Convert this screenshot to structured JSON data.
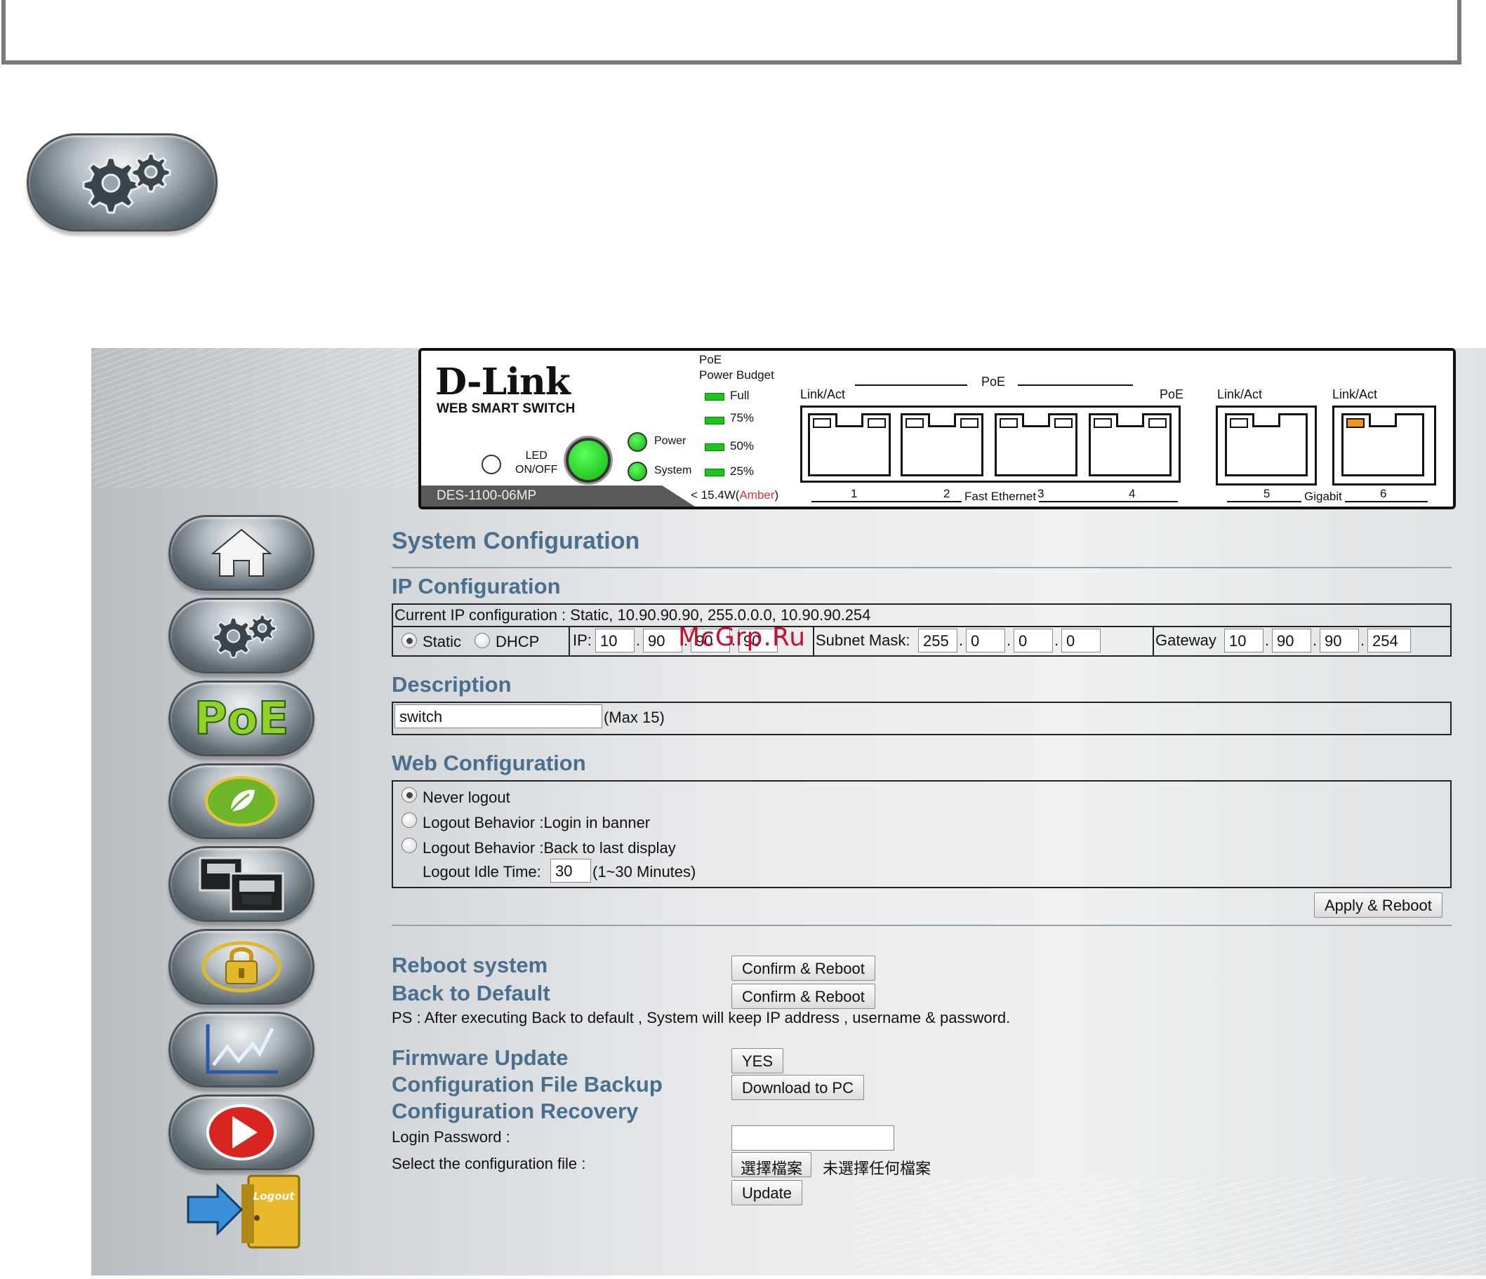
{
  "device": {
    "brand": "D-Link",
    "subtitle": "WEB SMART SWITCH",
    "model": "DES-1100-06MP",
    "led_label_1": "LED",
    "led_label_2": "ON/OFF",
    "power_label": "Power",
    "system_label": "System",
    "poe_budget_1": "PoE",
    "poe_budget_2": "Power Budget",
    "budget_levels": [
      "Full",
      "75%",
      "50%",
      "25%"
    ],
    "budget_note_prefix": "< 15.4W(",
    "budget_note_amber": "Amber",
    "budget_note_suffix": ")",
    "link_act": "Link/Act",
    "poe_group": "PoE",
    "poe_label": "PoE",
    "fast_ethernet": "Fast Ethernet",
    "gigabit": "Gigabit",
    "port_numbers": [
      "1",
      "2",
      "3",
      "4",
      "5",
      "6"
    ]
  },
  "page": {
    "title": "System Configuration",
    "ip_section": "IP Configuration",
    "current_ip": "Current IP configuration : Static, 10.90.90.90, 255.0.0.0, 10.90.90.254",
    "static_label": "Static",
    "dhcp_label": "DHCP",
    "ip_label": "IP:",
    "ip": [
      "10",
      "90",
      "90",
      "90"
    ],
    "subnet_label": "Subnet Mask:",
    "subnet": [
      "255",
      "0",
      "0",
      "0"
    ],
    "gateway_label": "Gateway",
    "gateway": [
      "10",
      "90",
      "90",
      "254"
    ],
    "dot": ".",
    "description_section": "Description",
    "description_value": "switch",
    "description_max": "(Max 15)",
    "web_section": "Web Configuration",
    "never_logout": "Never logout",
    "logout_banner": "Logout Behavior :Login in banner",
    "logout_back": "Logout Behavior :Back to last display",
    "idle_label": "Logout Idle Time:",
    "idle_value": "30",
    "idle_range": "(1~30 Minutes)",
    "apply_reboot": "Apply & Reboot",
    "reboot_system": "Reboot system",
    "back_default": "Back to Default",
    "confirm_reboot": "Confirm & Reboot",
    "ps_note": "PS : After executing Back to default , System will keep IP address , username & password.",
    "firmware_update": "Firmware Update",
    "yes": "YES",
    "config_backup": "Configuration File Backup",
    "download_pc": "Download to PC",
    "config_recovery": "Configuration Recovery",
    "login_password": "Login Password :",
    "select_file": "Select the configuration file :",
    "choose_file": "選擇檔案",
    "no_file": "未選擇任何檔案",
    "update": "Update"
  },
  "sidebar": {
    "icons": [
      "home-icon",
      "gear-icon",
      "poe-icon",
      "green-leaf-icon",
      "port-icon",
      "lock-icon",
      "chart-icon",
      "play-icon"
    ],
    "logout_label": "Logout",
    "poe_text": "PoE"
  },
  "watermark": "McGrp.Ru"
}
